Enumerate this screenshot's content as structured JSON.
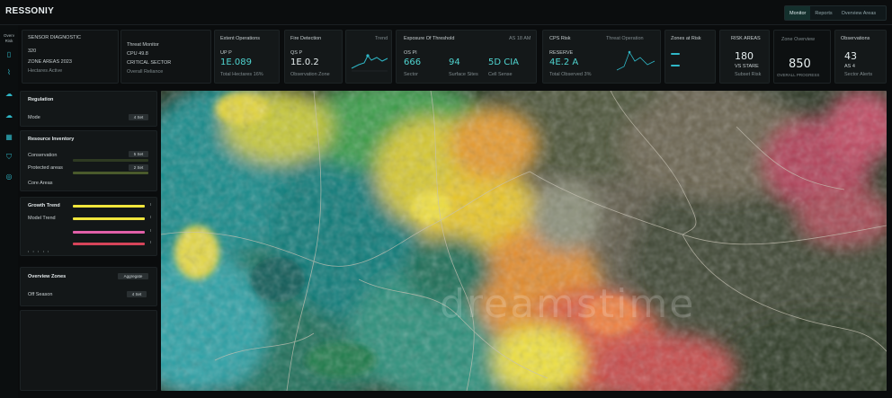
{
  "app": {
    "title": "RESSONIY"
  },
  "top_nav": {
    "items": [
      "Monitor",
      "Reports",
      "Overview Areas"
    ],
    "active": 0
  },
  "rail": {
    "label_1": "Overv",
    "label_2": "Risk"
  },
  "kpi_cards": {
    "c1": {
      "line1": "SENSOR DIAGNOSTIC",
      "line2": "320",
      "line3": "ZONE AREAS 2023",
      "line4": "Hectares Active"
    },
    "c2": {
      "line1": "Threat Monitor",
      "line2": "CPU 49.8",
      "line3": "CRITICAL SECTOR",
      "line4": "Overall Reliance"
    },
    "c3": {
      "title": "Extent Operations",
      "label": "UP P",
      "value": "1E.089",
      "foot": "Total Hectares 16%"
    },
    "c4": {
      "title": "Fire Detection",
      "label": "QS P",
      "value": "1E.0.2",
      "foot": "Observation Zone"
    },
    "c5": {
      "header": "Trend"
    },
    "c6": {
      "title": "Exposure Of Threshold",
      "right": "AS 18 AM",
      "sub_label": "OS PI",
      "v1": "666",
      "v2": "94",
      "v3": "5D CIA",
      "f1": "Sector",
      "f2": "Surface Sites",
      "f3": "Cell Sense"
    },
    "c7": {
      "title": "CPS Risk",
      "right": "Threat Operation",
      "label": "RESERVE",
      "value": "4E.2 A",
      "foot": "Total Observed 3%"
    },
    "c8": {
      "title": "Zones at Risk"
    },
    "c9": {
      "title": "RISK AREAS",
      "value": "180",
      "sub": "VS STARE",
      "foot": "Subset Risk"
    },
    "c10": {
      "title": "Zone Overview",
      "value": "850",
      "foot": "OVERALL PROGRESS"
    },
    "c11": {
      "title": "Observations",
      "value": "43",
      "sub": "AS 4",
      "foot": "Sector Alerts"
    }
  },
  "sidebar": {
    "p1": {
      "title": "Regulation",
      "row": "Mode",
      "pill": "4 Set"
    },
    "p2": {
      "title": "Resource Inventory",
      "rows": [
        {
          "label": "Conservation",
          "pill": "5 Set"
        },
        {
          "label": "Protected areas",
          "pill": "2 Set"
        },
        {
          "label": "Core Areas",
          "pill": ""
        }
      ]
    },
    "p3": {
      "title": "Growth Trend",
      "label2": "Model Trend"
    },
    "p4": {
      "title": "Overview Zones",
      "pill": "Aggregate",
      "row": "Off Season",
      "pill2": "4 Set"
    }
  },
  "colors": {
    "accent": "#2fb8c8",
    "bar_yellow": "#f0e63c",
    "bar_pink": "#e05fa8",
    "bar_red": "#d6445a",
    "bar_olive": "#4a5a2c"
  },
  "watermark": "dreamstime"
}
